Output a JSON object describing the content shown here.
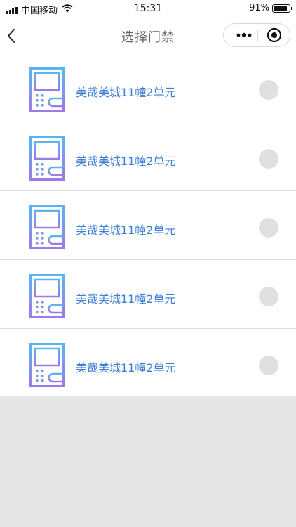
{
  "status": {
    "carrier": "中国移动",
    "time": "15:31",
    "battery": "91%",
    "battery_level": 0.91
  },
  "nav": {
    "title": "选择门禁",
    "icons": [
      "back-chevron-icon",
      "more-dots-icon",
      "target-icon"
    ]
  },
  "colors": {
    "label": "#3e7fd6",
    "icon_gradient_top": "#5ab4ef",
    "icon_gradient_bottom": "#9b7be8",
    "radio": "#e0e0e0"
  },
  "doors": [
    {
      "name": "美哉美城11幢2单元",
      "icon": "door-intercom-icon",
      "selected": false
    },
    {
      "name": "美哉美城11幢2单元",
      "icon": "door-intercom-icon",
      "selected": false
    },
    {
      "name": "美哉美城11幢2单元",
      "icon": "door-intercom-icon",
      "selected": false
    },
    {
      "name": "美哉美城11幢2单元",
      "icon": "door-intercom-icon",
      "selected": false
    },
    {
      "name": "美哉美城11幢2单元",
      "icon": "door-intercom-icon",
      "selected": false
    }
  ]
}
